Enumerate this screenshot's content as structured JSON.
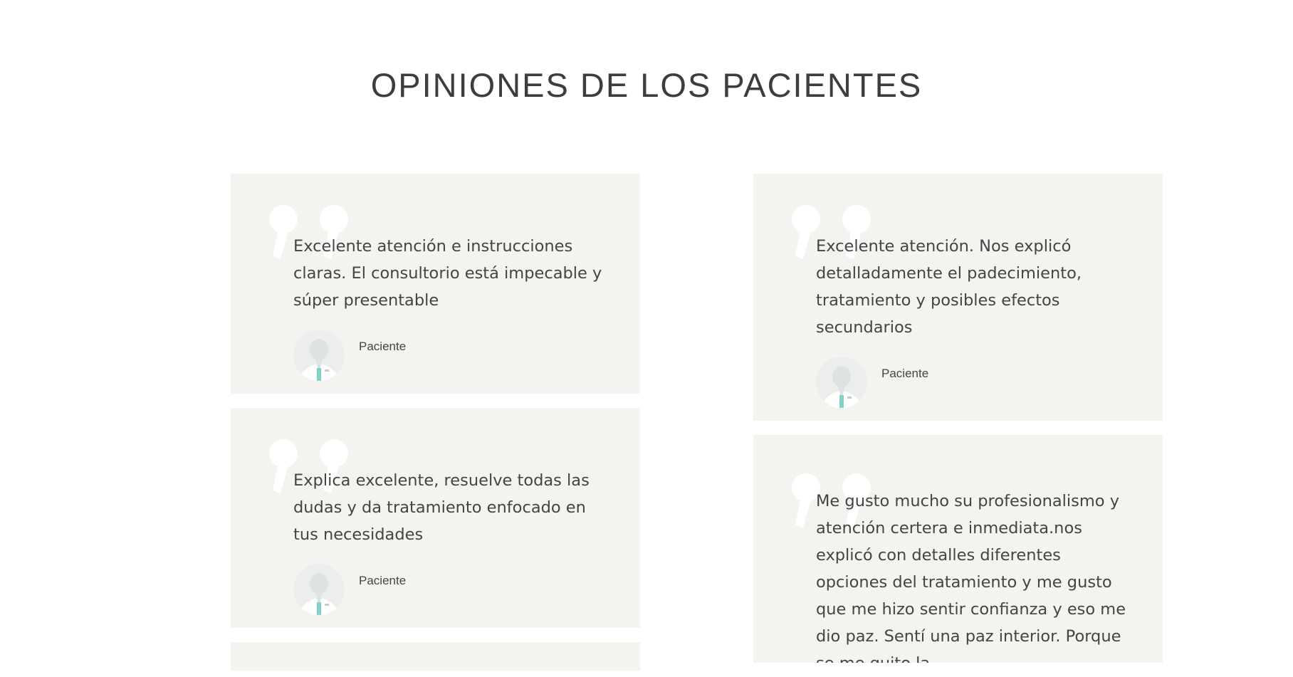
{
  "section": {
    "title": "OPINIONES DE LOS PACIENTES"
  },
  "colors": {
    "card_background": "#f4f3f0",
    "text": "#444444",
    "accent": "#7fd3c8"
  },
  "testimonials": [
    {
      "text": "Excelente atención e instrucciones claras. El consultorio está impecable y súper presentable",
      "author": "Paciente",
      "icon": "quote-icon",
      "avatar": "doctor-avatar"
    },
    {
      "text": "Explica excelente, resuelve todas las dudas y da tratamiento enfocado en tus necesidades",
      "author": "Paciente",
      "icon": "quote-icon",
      "avatar": "doctor-avatar"
    },
    {
      "text": "Excelente atención. Nos explicó detalladamente el padecimiento, tratamiento y posibles efectos secundarios",
      "author": "Paciente",
      "icon": "quote-icon",
      "avatar": "doctor-avatar"
    },
    {
      "text": "Me gusto mucho su profesionalismo y atención certera e inmediata.nos explicó con detalles diferentes opciones del tratamiento y me gusto que me hizo sentir confianza y eso me dio paz. Sentí una paz interior. Porque se me quito la",
      "author": "",
      "icon": "quote-icon",
      "avatar": ""
    }
  ]
}
